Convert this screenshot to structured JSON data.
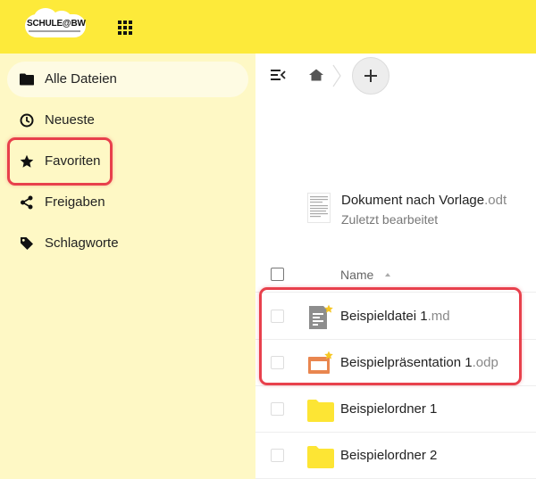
{
  "header": {
    "logo_text": "SCHULE@BW",
    "logo_alt": "SCHULE@BW Logo"
  },
  "sidebar": {
    "items": [
      {
        "label": "Alle Dateien",
        "icon": "folder-icon",
        "active": true
      },
      {
        "label": "Neueste",
        "icon": "clock-icon",
        "active": false
      },
      {
        "label": "Favoriten",
        "icon": "star-icon",
        "active": false
      },
      {
        "label": "Freigaben",
        "icon": "share-icon",
        "active": false
      },
      {
        "label": "Schlagworte",
        "icon": "tag-icon",
        "active": false
      }
    ]
  },
  "breadcrumb": {
    "add_label": "+"
  },
  "recent": {
    "name": "Dokument nach Vorlage",
    "ext": ".odt",
    "subtitle": "Zuletzt bearbeitet"
  },
  "list": {
    "column_name": "Name",
    "rows": [
      {
        "name": "Beispieldatei 1",
        "ext": ".md",
        "type": "text-file-icon",
        "favorite": true
      },
      {
        "name": "Beispielpräsentation 1",
        "ext": ".odp",
        "type": "presentation-file-icon",
        "favorite": true
      },
      {
        "name": "Beispielordner 1",
        "ext": "",
        "type": "folder-icon",
        "favorite": false
      },
      {
        "name": "Beispielordner 2",
        "ext": "",
        "type": "folder-icon",
        "favorite": false
      }
    ]
  },
  "colors": {
    "header_bg": "#fdea3a",
    "sidebar_bg": "#fef8c5",
    "highlight": "#e8404c",
    "folder": "#fde534",
    "presentation": "#e9864f",
    "star": "#f6c623"
  }
}
